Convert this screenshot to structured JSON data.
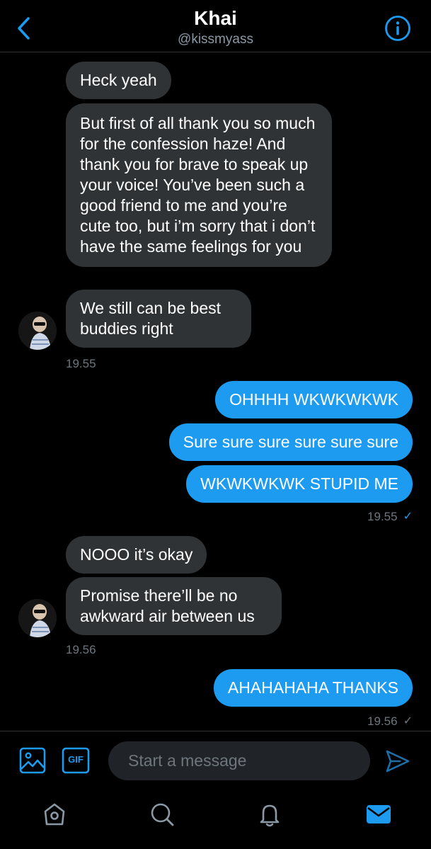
{
  "header": {
    "title": "Khai",
    "handle": "@kissmyass"
  },
  "messages": {
    "m1": "Heck yeah",
    "m2": "But first of all thank you so much for the confession haze! And thank you for brave to speak up your voice! You’ve been such a good friend to me and you’re cute too, but i’m sorry that i don’t have the same feelings for you",
    "m3": "We still can be best buddies right",
    "t1": "19.55",
    "m4": "OHHHH WKWKWKWK",
    "m5": "Sure sure sure sure sure sure",
    "m6": "WKWKWKWK STUPID ME",
    "t2": "19.55",
    "m7": "NOOO it’s okay",
    "m8": "Promise there’ll be no awkward air between us",
    "t3": "19.56",
    "m9": "AHAHAHAHA THANKS",
    "t4": "19.56"
  },
  "composer": {
    "placeholder": "Start a message",
    "gif_label": "GIF"
  },
  "colors": {
    "accent": "#1d9bf0",
    "incoming_bubble": "#2f3336",
    "background": "#000000",
    "secondary_text": "#8b98a5"
  },
  "icons": {
    "back": "chevron-left-icon",
    "info": "info-icon",
    "image": "image-icon",
    "gif": "gif-icon",
    "send": "send-icon",
    "home": "home-icon",
    "search": "search-icon",
    "notifications": "bell-icon",
    "messages": "mail-icon"
  }
}
